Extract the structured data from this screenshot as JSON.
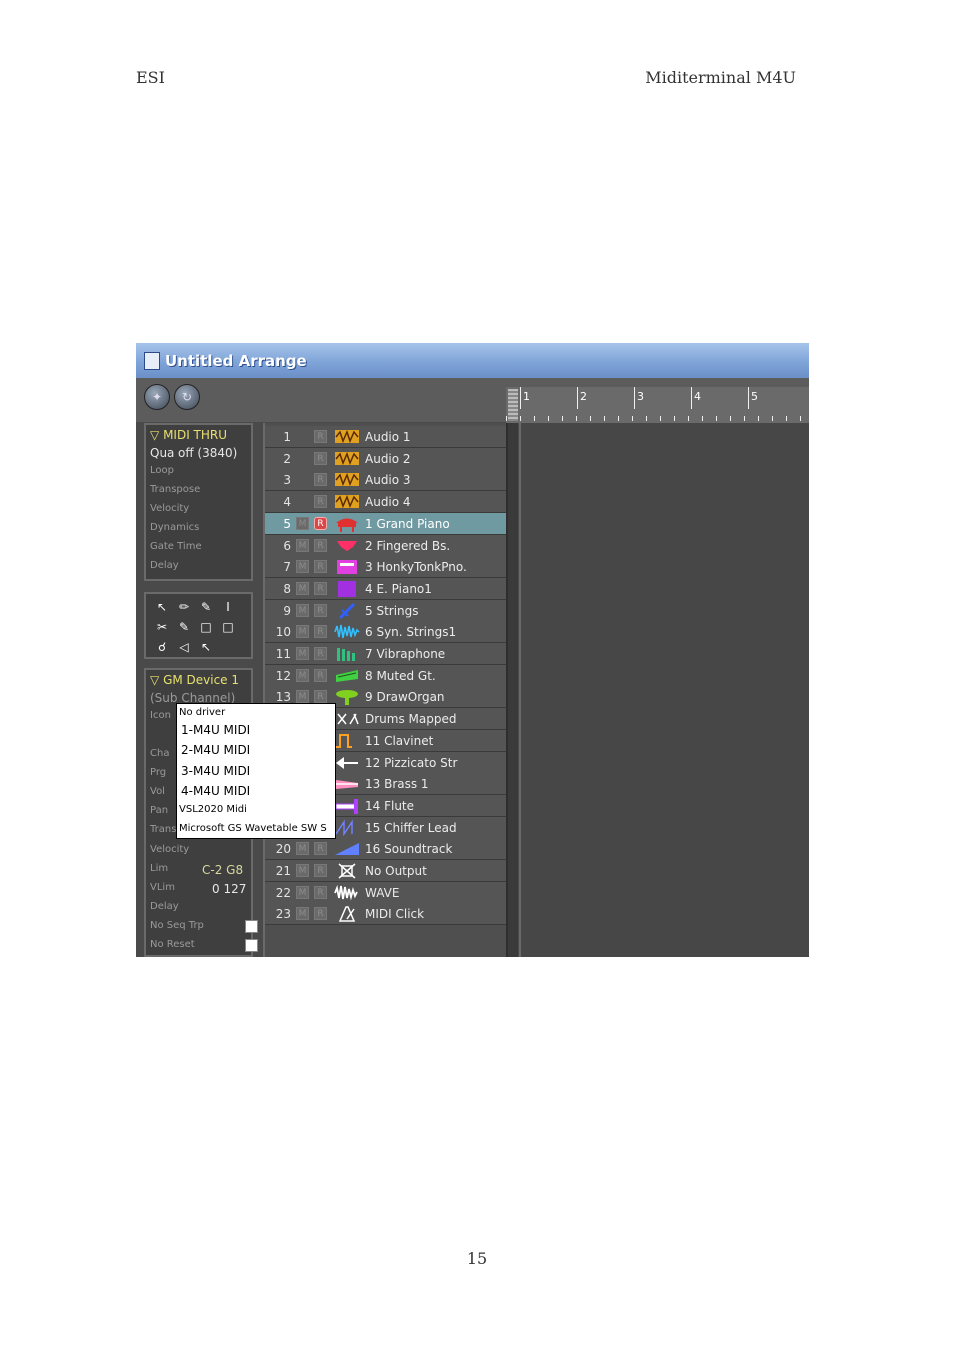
{
  "page": {
    "header_left": "ESI",
    "header_right": "Miditerminal M4U",
    "page_number": "15"
  },
  "window": {
    "title": "Untitled Arrange"
  },
  "midi_panel": {
    "title": "MIDI THRU",
    "qua_label": "Qua",
    "qua_value": "off (3840)",
    "rows": [
      "Loop",
      "Transpose",
      "Velocity",
      "Dynamics",
      "Gate Time",
      "Delay"
    ]
  },
  "gm_panel": {
    "title": "GM Device  1",
    "subtitle": "(Sub Channel)",
    "icon_label": "Icon",
    "labels": [
      "Cha",
      "Prg",
      "Vol",
      "Pan",
      "Trans",
      "Velocity",
      "Lim",
      "VLim",
      "Delay",
      "No Seq Trp",
      "No Reset"
    ],
    "lim_value": "C-2  G8",
    "vlim_value": "0  127"
  },
  "ruler": {
    "bars": [
      "1",
      "2",
      "3",
      "4",
      "5"
    ]
  },
  "tracks": [
    {
      "num": "1",
      "name": "Audio 1",
      "m": false,
      "r": "R",
      "icon": "audio-icon"
    },
    {
      "num": "2",
      "name": "Audio 2",
      "m": false,
      "r": "R",
      "icon": "audio-icon"
    },
    {
      "num": "3",
      "name": "Audio 3",
      "m": false,
      "r": "R",
      "icon": "audio-icon"
    },
    {
      "num": "4",
      "name": "Audio 4",
      "m": false,
      "r": "R",
      "icon": "audio-icon"
    },
    {
      "num": "5",
      "name": "1   Grand Piano",
      "m": true,
      "r": "R",
      "icon": "piano-icon",
      "selected": true
    },
    {
      "num": "6",
      "name": "2   Fingered Bs.",
      "m": true,
      "r": "R",
      "icon": "bass-icon"
    },
    {
      "num": "7",
      "name": "3   HonkyTonkPno.",
      "m": true,
      "r": "R",
      "icon": "honkytonk-icon"
    },
    {
      "num": "8",
      "name": "4   E. Piano1",
      "m": true,
      "r": "R",
      "icon": "epiano-icon"
    },
    {
      "num": "9",
      "name": "5   Strings",
      "m": true,
      "r": "R",
      "icon": "strings-icon"
    },
    {
      "num": "10",
      "name": "6   Syn. Strings1",
      "m": true,
      "r": "R",
      "icon": "synth-strings-icon"
    },
    {
      "num": "11",
      "name": "7   Vibraphone",
      "m": true,
      "r": "R",
      "icon": "vibraphone-icon"
    },
    {
      "num": "12",
      "name": "8   Muted Gt.",
      "m": true,
      "r": "R",
      "icon": "guitar-icon"
    },
    {
      "num": "13",
      "name": "9   DrawOrgan",
      "m": true,
      "r": "R",
      "icon": "organ-icon"
    },
    {
      "num": "",
      "name": "Drums Mapped",
      "m": false,
      "r": "",
      "icon": "drums-icon"
    },
    {
      "num": "",
      "name": "11   Clavinet",
      "m": false,
      "r": "",
      "icon": "clavinet-icon"
    },
    {
      "num": "",
      "name": "12   Pizzicato Str",
      "m": false,
      "r": "",
      "icon": "pizzicato-icon"
    },
    {
      "num": "",
      "name": "13   Brass 1",
      "m": false,
      "r": "",
      "icon": "brass-icon"
    },
    {
      "num": "",
      "name": "14   Flute",
      "m": false,
      "r": "",
      "icon": "flute-icon"
    },
    {
      "num": "",
      "name": "15   Chiffer Lead",
      "m": false,
      "r": "",
      "icon": "lead-icon"
    },
    {
      "num": "20",
      "name": "16   Soundtrack",
      "m": true,
      "r": "R",
      "icon": "soundtrack-icon"
    },
    {
      "num": "21",
      "name": "No Output",
      "m": true,
      "r": "R",
      "icon": "no-output-icon"
    },
    {
      "num": "22",
      "name": "WAVE",
      "m": true,
      "r": "R",
      "icon": "wave-icon"
    },
    {
      "num": "23",
      "name": "MIDI Click",
      "m": true,
      "r": "R",
      "icon": "metronome-icon"
    }
  ],
  "dropdown": {
    "items": [
      "No driver",
      "1-M4U MIDI",
      "2-M4U MIDI",
      "3-M4U MIDI",
      "4-M4U MIDI",
      "VSL2020 Midi",
      "Microsoft GS Wavetable SW S"
    ]
  },
  "colors": {
    "titlebar": "#7fa4d8",
    "panel_bg": "#3f3f3f",
    "selected_track": "#6f9aa1",
    "record_on": "#d84848",
    "panel_title": "#e8e070"
  }
}
